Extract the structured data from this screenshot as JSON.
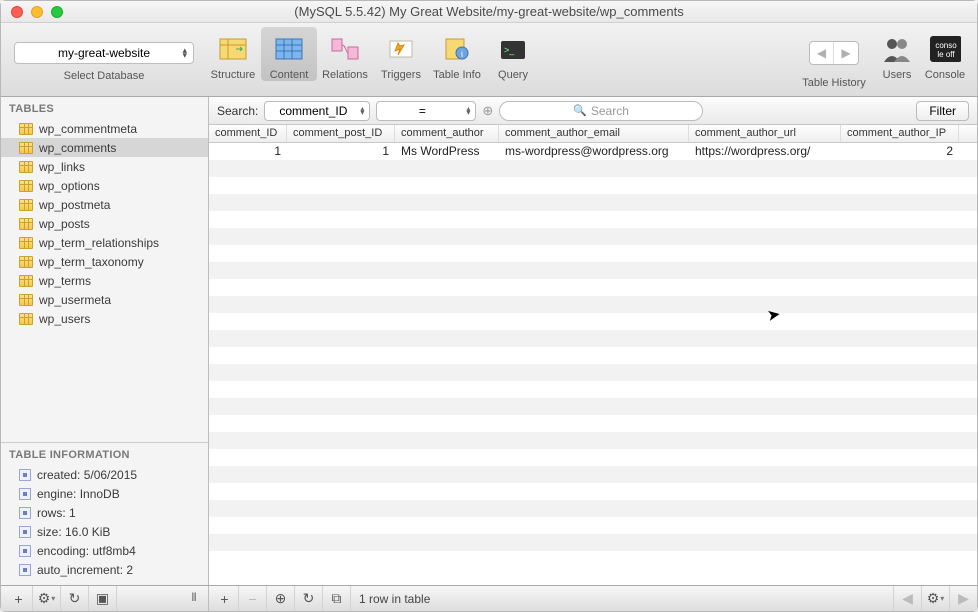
{
  "window": {
    "title": "(MySQL 5.5.42) My Great Website/my-great-website/wp_comments"
  },
  "toolbar": {
    "database_selected": "my-great-website",
    "database_label": "Select Database",
    "buttons": {
      "structure": "Structure",
      "content": "Content",
      "relations": "Relations",
      "triggers": "Triggers",
      "tableinfo": "Table Info",
      "query": "Query"
    },
    "right": {
      "history": "Table History",
      "users": "Users",
      "console": "Console"
    }
  },
  "sidebar": {
    "tables_header": "TABLES",
    "tables": [
      "wp_commentmeta",
      "wp_comments",
      "wp_links",
      "wp_options",
      "wp_postmeta",
      "wp_posts",
      "wp_term_relationships",
      "wp_term_taxonomy",
      "wp_terms",
      "wp_usermeta",
      "wp_users"
    ],
    "selected_index": 1,
    "info_header": "TABLE INFORMATION",
    "info": [
      "created: 5/06/2015",
      "engine: InnoDB",
      "rows: 1",
      "size: 16.0 KiB",
      "encoding: utf8mb4",
      "auto_increment: 2"
    ]
  },
  "search": {
    "label": "Search:",
    "field": "comment_ID",
    "operator": "=",
    "placeholder": "Search",
    "filter_label": "Filter"
  },
  "grid": {
    "columns": [
      "comment_ID",
      "comment_post_ID",
      "comment_author",
      "comment_author_email",
      "comment_author_url",
      "comment_author_IP"
    ],
    "rows": [
      {
        "comment_ID": "1",
        "comment_post_ID": "1",
        "comment_author": "Ms WordPress",
        "comment_author_email": "ms-wordpress@wordpress.org",
        "comment_author_url": "https://wordpress.org/",
        "comment_author_IP": "2"
      }
    ]
  },
  "status": {
    "text": "1 row in table"
  }
}
